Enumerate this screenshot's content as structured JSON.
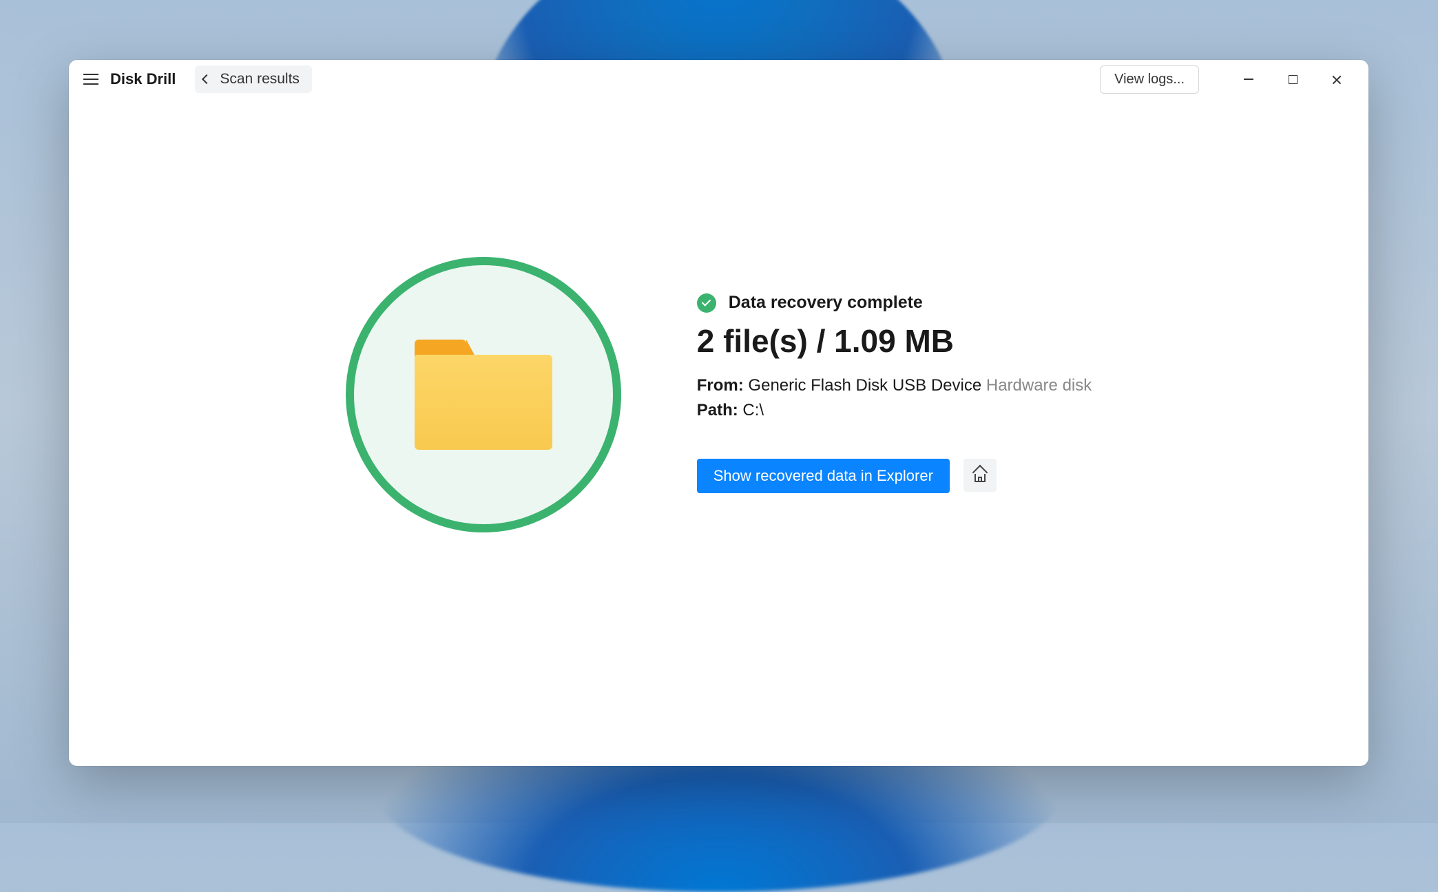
{
  "header": {
    "app_title": "Disk Drill",
    "breadcrumb": "Scan results",
    "view_logs_label": "View logs..."
  },
  "main": {
    "status_text": "Data recovery complete",
    "result_summary": "2 file(s) / 1.09 MB",
    "from_label": "From:",
    "from_value": "Generic Flash Disk USB Device",
    "from_type": "Hardware disk",
    "path_label": "Path:",
    "path_value": "C:\\",
    "show_in_explorer_label": "Show recovered data in Explorer"
  },
  "colors": {
    "success_green": "#3bb36f",
    "primary_blue": "#0a84ff",
    "folder_yellow": "#f8c94e",
    "folder_tab": "#f5a623"
  }
}
